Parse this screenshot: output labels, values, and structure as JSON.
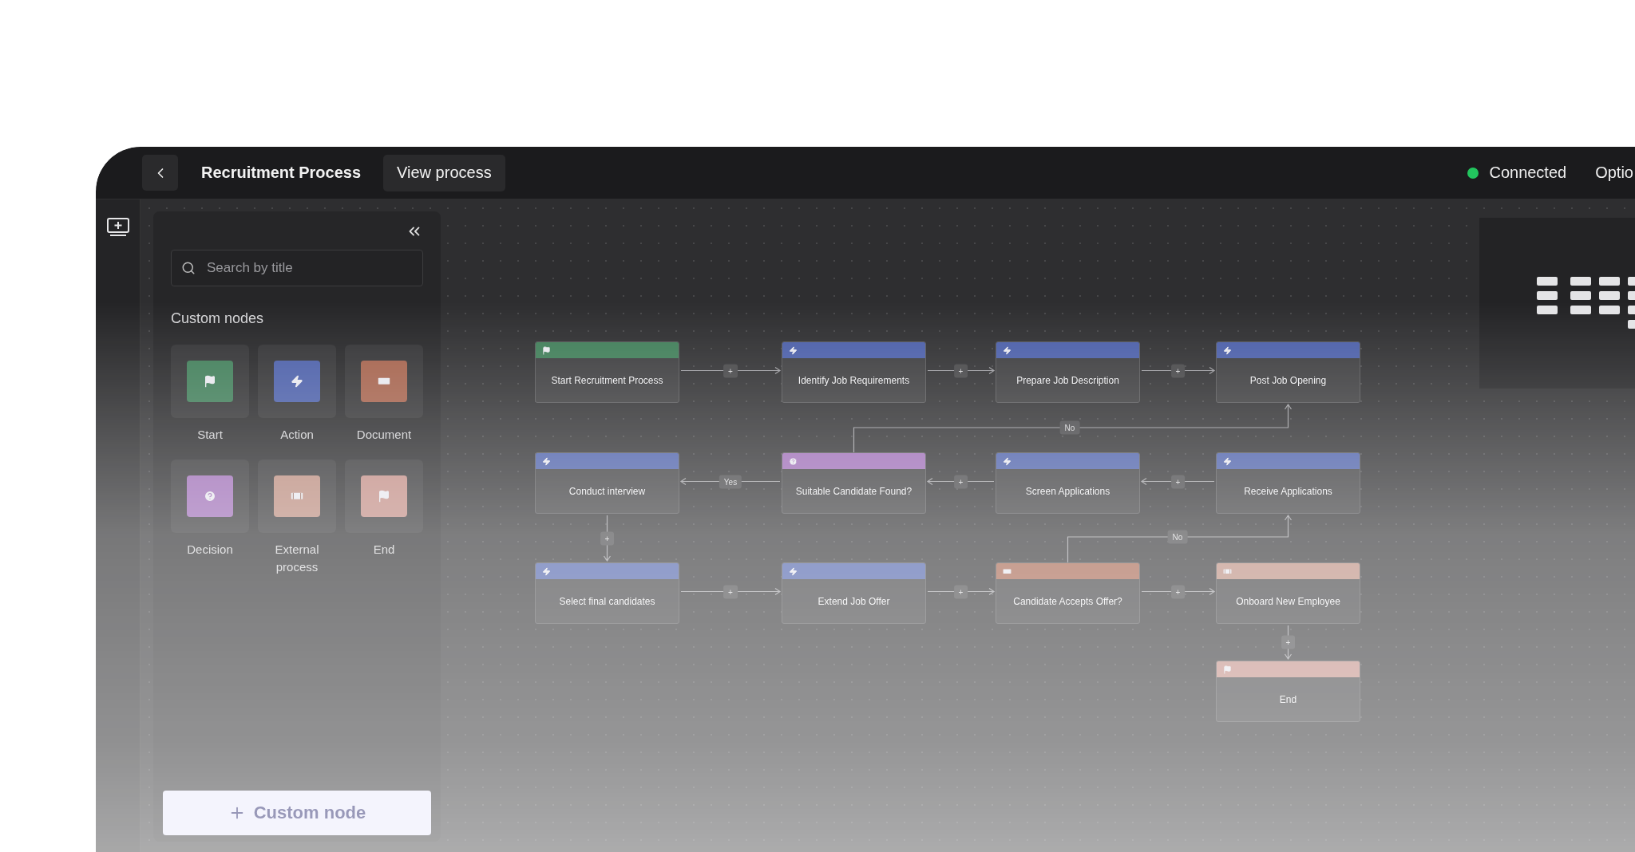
{
  "header": {
    "title": "Recruitment Process",
    "view_button": "View process",
    "status": "Connected",
    "options": "Optio"
  },
  "palette": {
    "search": {
      "placeholder": "Search by title"
    },
    "section": "Custom nodes",
    "nodes": [
      {
        "kind": "start",
        "label": "Start"
      },
      {
        "kind": "action",
        "label": "Action"
      },
      {
        "kind": "document",
        "label": "Document"
      },
      {
        "kind": "decision",
        "label": "Decision"
      },
      {
        "kind": "external",
        "label": "External process"
      },
      {
        "kind": "end",
        "label": "End"
      }
    ],
    "add_button": "Custom node"
  },
  "flow": {
    "nodes": [
      {
        "kind": "start",
        "label": "Start Recruitment Process"
      },
      {
        "kind": "action",
        "label": "Identify Job Requirements"
      },
      {
        "kind": "action",
        "label": "Prepare Job Description"
      },
      {
        "kind": "action",
        "label": "Post Job Opening"
      },
      {
        "kind": "action",
        "label": "Conduct interview"
      },
      {
        "kind": "decision",
        "label": "Suitable Candidate Found?"
      },
      {
        "kind": "action",
        "label": "Screen Applications"
      },
      {
        "kind": "action",
        "label": "Receive Applications"
      },
      {
        "kind": "action",
        "label": "Select final candidates"
      },
      {
        "kind": "action",
        "label": "Extend Job Offer"
      },
      {
        "kind": "document",
        "label": "Candidate Accepts Offer?"
      },
      {
        "kind": "external",
        "label": "Onboard New Employee"
      },
      {
        "kind": "end",
        "label": "End"
      }
    ],
    "edges": [
      {
        "label": "+"
      },
      {
        "label": "+"
      },
      {
        "label": "+"
      },
      {
        "label": "No"
      },
      {
        "label": "Yes"
      },
      {
        "label": "+"
      },
      {
        "label": "+"
      },
      {
        "label": "+"
      },
      {
        "label": "No"
      },
      {
        "label": "+"
      },
      {
        "label": "+"
      },
      {
        "label": "+"
      },
      {
        "label": "+"
      }
    ]
  }
}
